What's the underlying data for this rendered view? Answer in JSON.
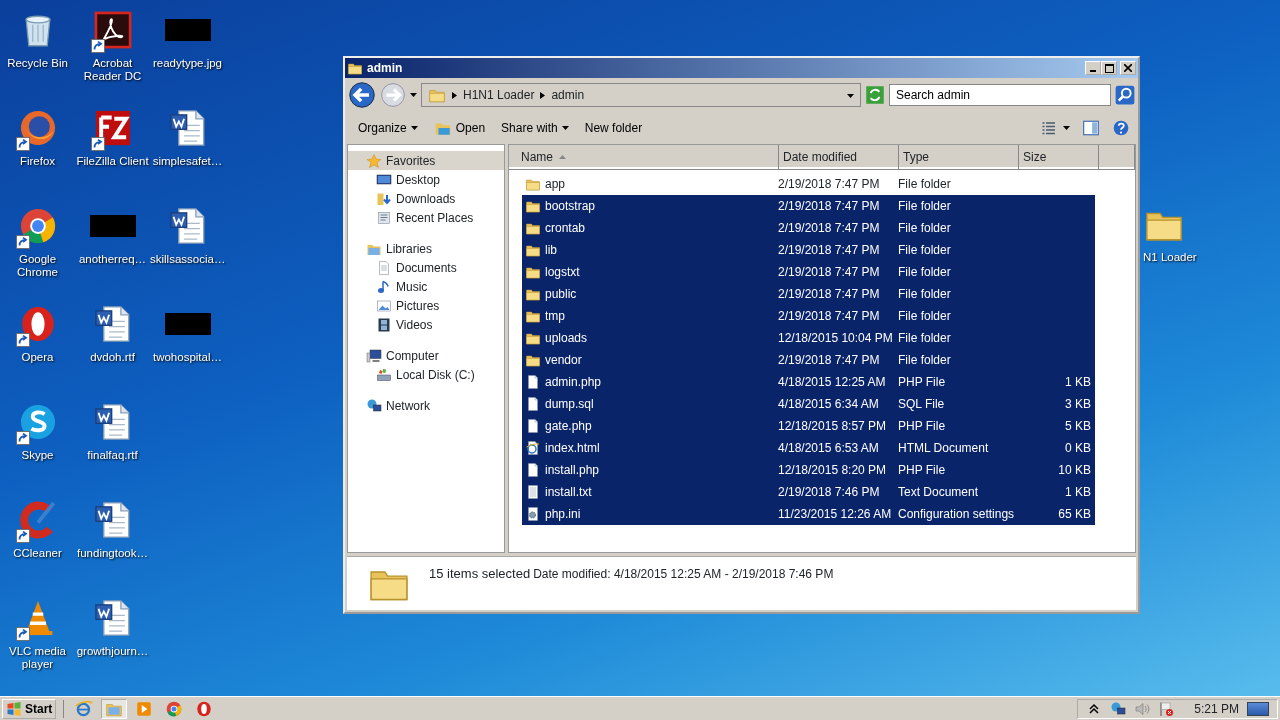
{
  "desktop": {
    "icons": [
      {
        "label": "Recycle Bin",
        "kind": "recycle",
        "shortcut": false
      },
      {
        "label": "Firefox",
        "kind": "firefox",
        "shortcut": true
      },
      {
        "label": "Google Chrome",
        "kind": "chrome",
        "shortcut": true
      },
      {
        "label": "Opera",
        "kind": "opera",
        "shortcut": true
      },
      {
        "label": "Skype",
        "kind": "skype",
        "shortcut": true
      },
      {
        "label": "CCleaner",
        "kind": "ccleaner",
        "shortcut": true
      },
      {
        "label": "VLC media player",
        "kind": "vlc",
        "shortcut": true
      },
      {
        "label": "Acrobat Reader DC",
        "kind": "pdf",
        "shortcut": true
      },
      {
        "label": "FileZilla Client",
        "kind": "filezilla",
        "shortcut": true
      },
      {
        "label": "anotherreq…",
        "kind": "redacted",
        "shortcut": false
      },
      {
        "label": "dvdoh.rtf",
        "kind": "word",
        "shortcut": false
      },
      {
        "label": "finalfaq.rtf",
        "kind": "word",
        "shortcut": false
      },
      {
        "label": "fundingtook…",
        "kind": "word",
        "shortcut": false
      },
      {
        "label": "growthjourn…",
        "kind": "word",
        "shortcut": false
      },
      {
        "label": "readytype.jpg",
        "kind": "redacted",
        "shortcut": false
      },
      {
        "label": "simplesafet…",
        "kind": "word",
        "shortcut": false
      },
      {
        "label": "skillsassocia…",
        "kind": "word",
        "shortcut": false
      },
      {
        "label": "twohospital…",
        "kind": "redacted",
        "shortcut": false
      }
    ],
    "partial_icon": {
      "label": "N1 Loader",
      "kind": "folder"
    }
  },
  "window": {
    "title": "admin",
    "address": [
      "H1N1 Loader",
      "admin"
    ],
    "search": {
      "placeholder": "Search admin"
    },
    "toolbar": [
      {
        "label": "Organize",
        "kind": "menu"
      },
      {
        "label": "Open",
        "kind": "open"
      },
      {
        "label": "Share with",
        "kind": "menu"
      },
      {
        "label": "New folder",
        "kind": "plain"
      }
    ],
    "sidebar": [
      {
        "label": "Favorites",
        "kind": "star",
        "selected": true,
        "children": [
          {
            "label": "Desktop",
            "kind": "desktop",
            "selected": false
          },
          {
            "label": "Downloads",
            "kind": "downloads",
            "selected": false
          },
          {
            "label": "Recent Places",
            "kind": "recent",
            "selected": false
          }
        ]
      },
      {
        "label": "Libraries",
        "kind": "libraries",
        "selected": false,
        "children": [
          {
            "label": "Documents",
            "kind": "documents",
            "selected": false
          },
          {
            "label": "Music",
            "kind": "music",
            "selected": false
          },
          {
            "label": "Pictures",
            "kind": "pictures",
            "selected": false
          },
          {
            "label": "Videos",
            "kind": "videos",
            "selected": false
          }
        ]
      },
      {
        "label": "Computer",
        "kind": "computer",
        "selected": false,
        "children": [
          {
            "label": "Local Disk (C:)",
            "kind": "disk",
            "selected": false
          }
        ]
      },
      {
        "label": "Network",
        "kind": "network",
        "selected": false
      }
    ],
    "columns": [
      {
        "label": "Name",
        "sorted": true
      },
      {
        "label": "Date modified",
        "sorted": false
      },
      {
        "label": "Type",
        "sorted": false
      },
      {
        "label": "Size",
        "sorted": false
      }
    ],
    "rows": [
      {
        "name": "app",
        "date": "2/19/2018 7:47 PM",
        "type": "File folder",
        "kind": "folder",
        "selected": false
      },
      {
        "name": "bootstrap",
        "date": "2/19/2018 7:47 PM",
        "type": "File folder",
        "kind": "folder",
        "selected": true
      },
      {
        "name": "crontab",
        "date": "2/19/2018 7:47 PM",
        "type": "File folder",
        "kind": "folder",
        "selected": true
      },
      {
        "name": "lib",
        "date": "2/19/2018 7:47 PM",
        "type": "File folder",
        "kind": "folder",
        "selected": true
      },
      {
        "name": "logstxt",
        "date": "2/19/2018 7:47 PM",
        "type": "File folder",
        "kind": "folder",
        "selected": true
      },
      {
        "name": "public",
        "date": "2/19/2018 7:47 PM",
        "type": "File folder",
        "kind": "folder",
        "selected": true
      },
      {
        "name": "tmp",
        "date": "2/19/2018 7:47 PM",
        "type": "File folder",
        "kind": "folder",
        "selected": true
      },
      {
        "name": "uploads",
        "date": "12/18/2015 10:04 PM",
        "type": "File folder",
        "kind": "folder",
        "selected": true
      },
      {
        "name": "vendor",
        "date": "2/19/2018 7:47 PM",
        "type": "File folder",
        "kind": "folder",
        "selected": true
      },
      {
        "name": "admin.php",
        "date": "4/18/2015 12:25 AM",
        "type": "PHP File",
        "size": "1 KB",
        "kind": "file",
        "selected": true
      },
      {
        "name": "dump.sql",
        "date": "4/18/2015 6:34 AM",
        "type": "SQL File",
        "size": "3 KB",
        "kind": "file",
        "selected": true
      },
      {
        "name": "gate.php",
        "date": "12/18/2015 8:57 PM",
        "type": "PHP File",
        "size": "5 KB",
        "kind": "file",
        "selected": true
      },
      {
        "name": "index.html",
        "date": "4/18/2015 6:53 AM",
        "type": "HTML Document",
        "size": "0 KB",
        "kind": "html",
        "selected": true
      },
      {
        "name": "install.php",
        "date": "12/18/2015 8:20 PM",
        "type": "PHP File",
        "size": "10 KB",
        "kind": "file",
        "selected": true
      },
      {
        "name": "install.txt",
        "date": "2/19/2018 7:46 PM",
        "type": "Text Document",
        "size": "1 KB",
        "kind": "text",
        "selected": true
      },
      {
        "name": "php.ini",
        "date": "11/23/2015 12:26 AM",
        "type": "Configuration settings",
        "size": "65 KB",
        "kind": "config",
        "selected": true
      }
    ],
    "details": {
      "count": "15 items selected",
      "dates": "Date modified: 4/18/2015 12:25 AM - 2/19/2018 7:46 PM"
    }
  },
  "taskbar": {
    "start": "Start",
    "apps": [
      {
        "kind": "ie",
        "active": false
      },
      {
        "kind": "explorer",
        "active": true
      },
      {
        "kind": "media",
        "active": false
      },
      {
        "kind": "chrome",
        "active": false
      },
      {
        "kind": "opera",
        "active": false
      }
    ],
    "tray": [
      {
        "kind": "up"
      },
      {
        "kind": "network"
      },
      {
        "kind": "volume"
      },
      {
        "kind": "flag"
      }
    ],
    "clock": "5:21 PM"
  }
}
